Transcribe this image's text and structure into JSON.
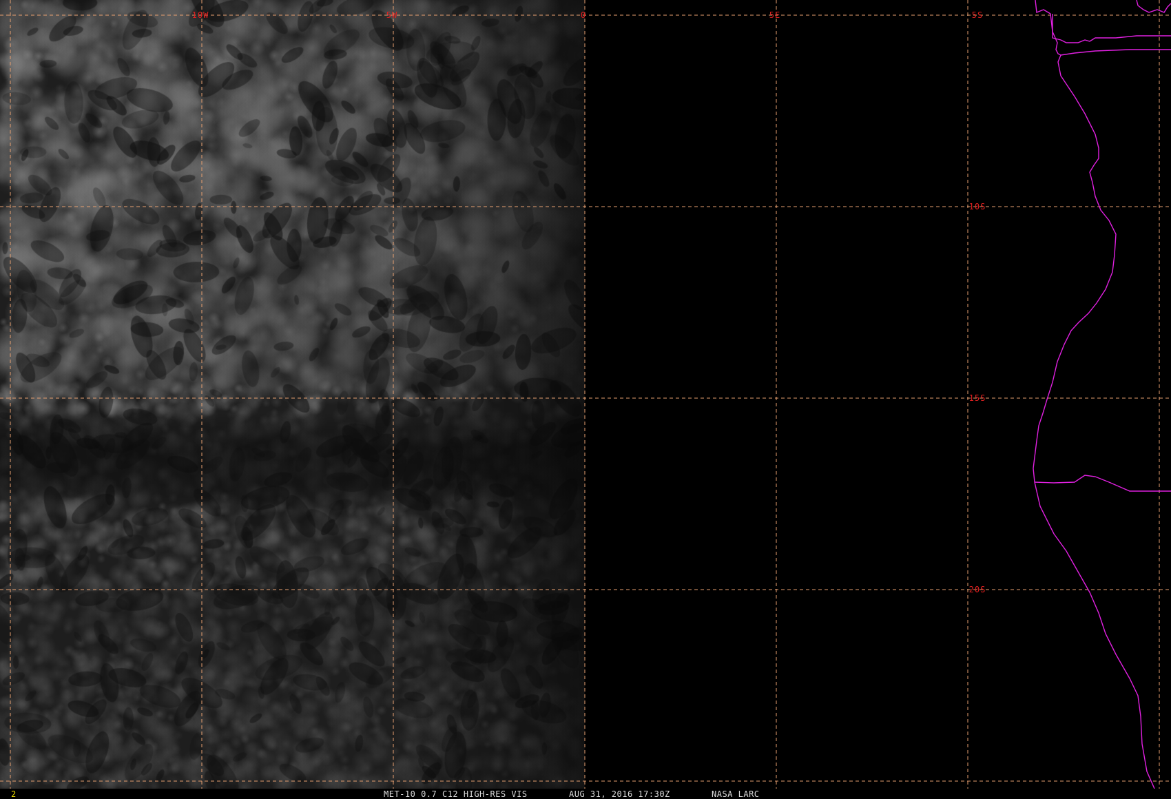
{
  "map": {
    "lon_labels": [
      {
        "text": "10W",
        "lon": -10
      },
      {
        "text": "5W",
        "lon": -5
      },
      {
        "text": "0",
        "lon": 0
      },
      {
        "text": "5E",
        "lon": 5
      }
    ],
    "lat_labels": [
      {
        "text": "5S",
        "lat": -5
      },
      {
        "text": "10S",
        "lat": -10
      },
      {
        "text": "15S",
        "lat": -15
      },
      {
        "text": "20S",
        "lat": -20
      }
    ],
    "grid_color": "#e8a070",
    "label_color": "#e02020",
    "border_color": "#e020e0",
    "imagery_terminator_lon": 0
  },
  "status": {
    "frame": "2",
    "satellite": "MET-10 0.7 C12 HIGH-RES VIS",
    "datetime": "AUG 31, 2016 17:30Z",
    "organization": "NASA LARC"
  }
}
